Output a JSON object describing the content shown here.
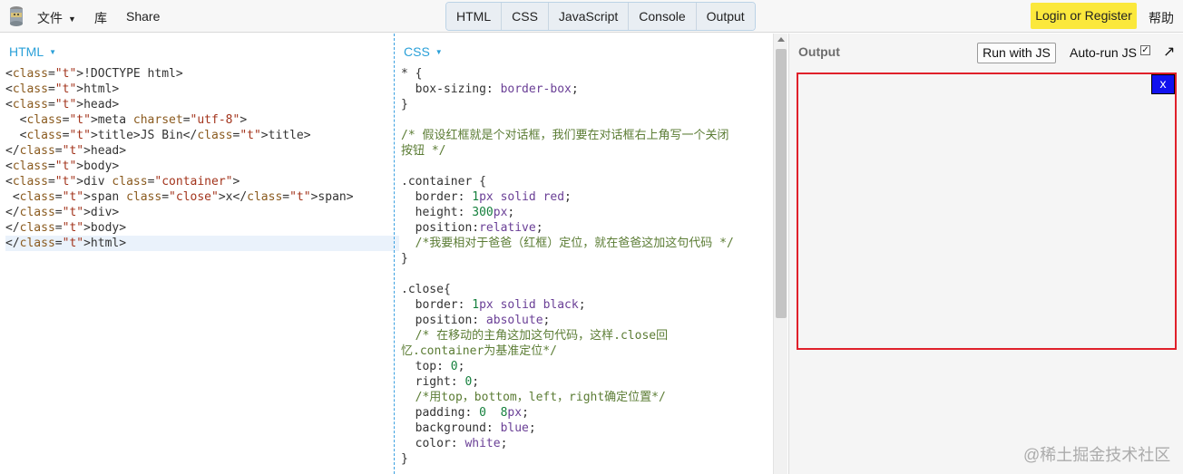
{
  "topbar": {
    "menu": [
      {
        "label": "文件",
        "has_caret": true
      },
      {
        "label": "库"
      },
      {
        "label": "Share"
      }
    ],
    "tabs": [
      "HTML",
      "CSS",
      "JavaScript",
      "Console",
      "Output"
    ],
    "login_label": "Login or Register",
    "help_label": "帮助"
  },
  "html_panel": {
    "label": "HTML"
  },
  "css_panel": {
    "label": "CSS"
  },
  "output_panel": {
    "label": "Output",
    "run_label": "Run with JS",
    "autorun_label": "Auto-run JS",
    "autorun_checked": true,
    "preview_close_text": "x",
    "preview_border_color": "#e0202a",
    "preview_close_bg": "#1111ee"
  },
  "watermark": "@稀土掘金技术社区",
  "html_code": [
    "<!DOCTYPE html>",
    "<html>",
    "<head>",
    "  <meta charset=\"utf-8\">",
    "  <title>JS Bin</title>",
    "</head>",
    "<body>",
    "<div class=\"container\">",
    " <span class=\"close\">x</span>",
    "</div>",
    "</body>",
    "</html>"
  ],
  "css_code": [
    "* {",
    "  box-sizing: border-box;",
    "}",
    "",
    "/* 假设红框就是个对话框，我们要在对话框右上角写一个关闭",
    "按钮 */",
    "",
    ".container {",
    "  border: 1px solid red;",
    "  height: 300px;",
    "  position:relative;",
    "  /*我要相对于爸爸（红框）定位，就在爸爸这加这句代码 */",
    "}",
    "",
    ".close{",
    "  border: 1px solid black;",
    "  position: absolute;",
    "  /* 在移动的主角这加这句代码，这样.close回",
    "忆.container为基准定位*/",
    "  top: 0;",
    "  right: 0;",
    "  /*用top，bottom，left，right确定位置*/",
    "  padding: 0  8px;",
    "  background: blue;",
    "  color: white;",
    "}"
  ]
}
